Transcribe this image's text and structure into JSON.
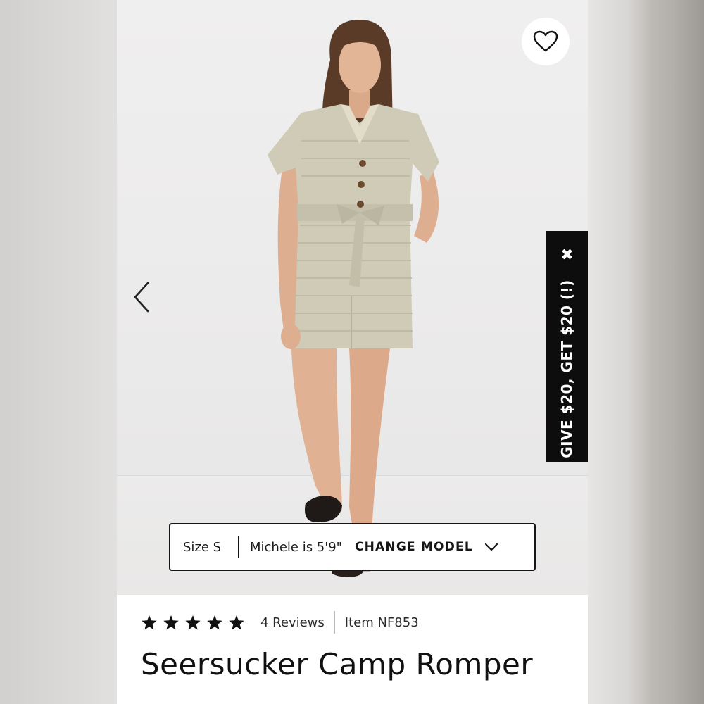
{
  "product_page": {
    "promo_banner": {
      "text": "GIVE $20, GET $20 (!)",
      "close_glyph": "✖"
    },
    "size_selector": {
      "size": "Size S",
      "model_info": "Michele is 5'9\"",
      "change_model_label": "CHANGE MODEL"
    },
    "rating": {
      "stars": 5,
      "reviews_label": "4 Reviews"
    },
    "item_number": "Item NF853",
    "title": "Seersucker Camp Romper",
    "icons": {
      "favorite": "heart-icon",
      "previous": "chevron-left-icon",
      "dropdown": "chevron-down-icon",
      "close": "close-icon",
      "star": "star-icon"
    },
    "colors": {
      "promo_bg": "#0d0d0d",
      "text": "#111111",
      "border": "#151515"
    }
  }
}
